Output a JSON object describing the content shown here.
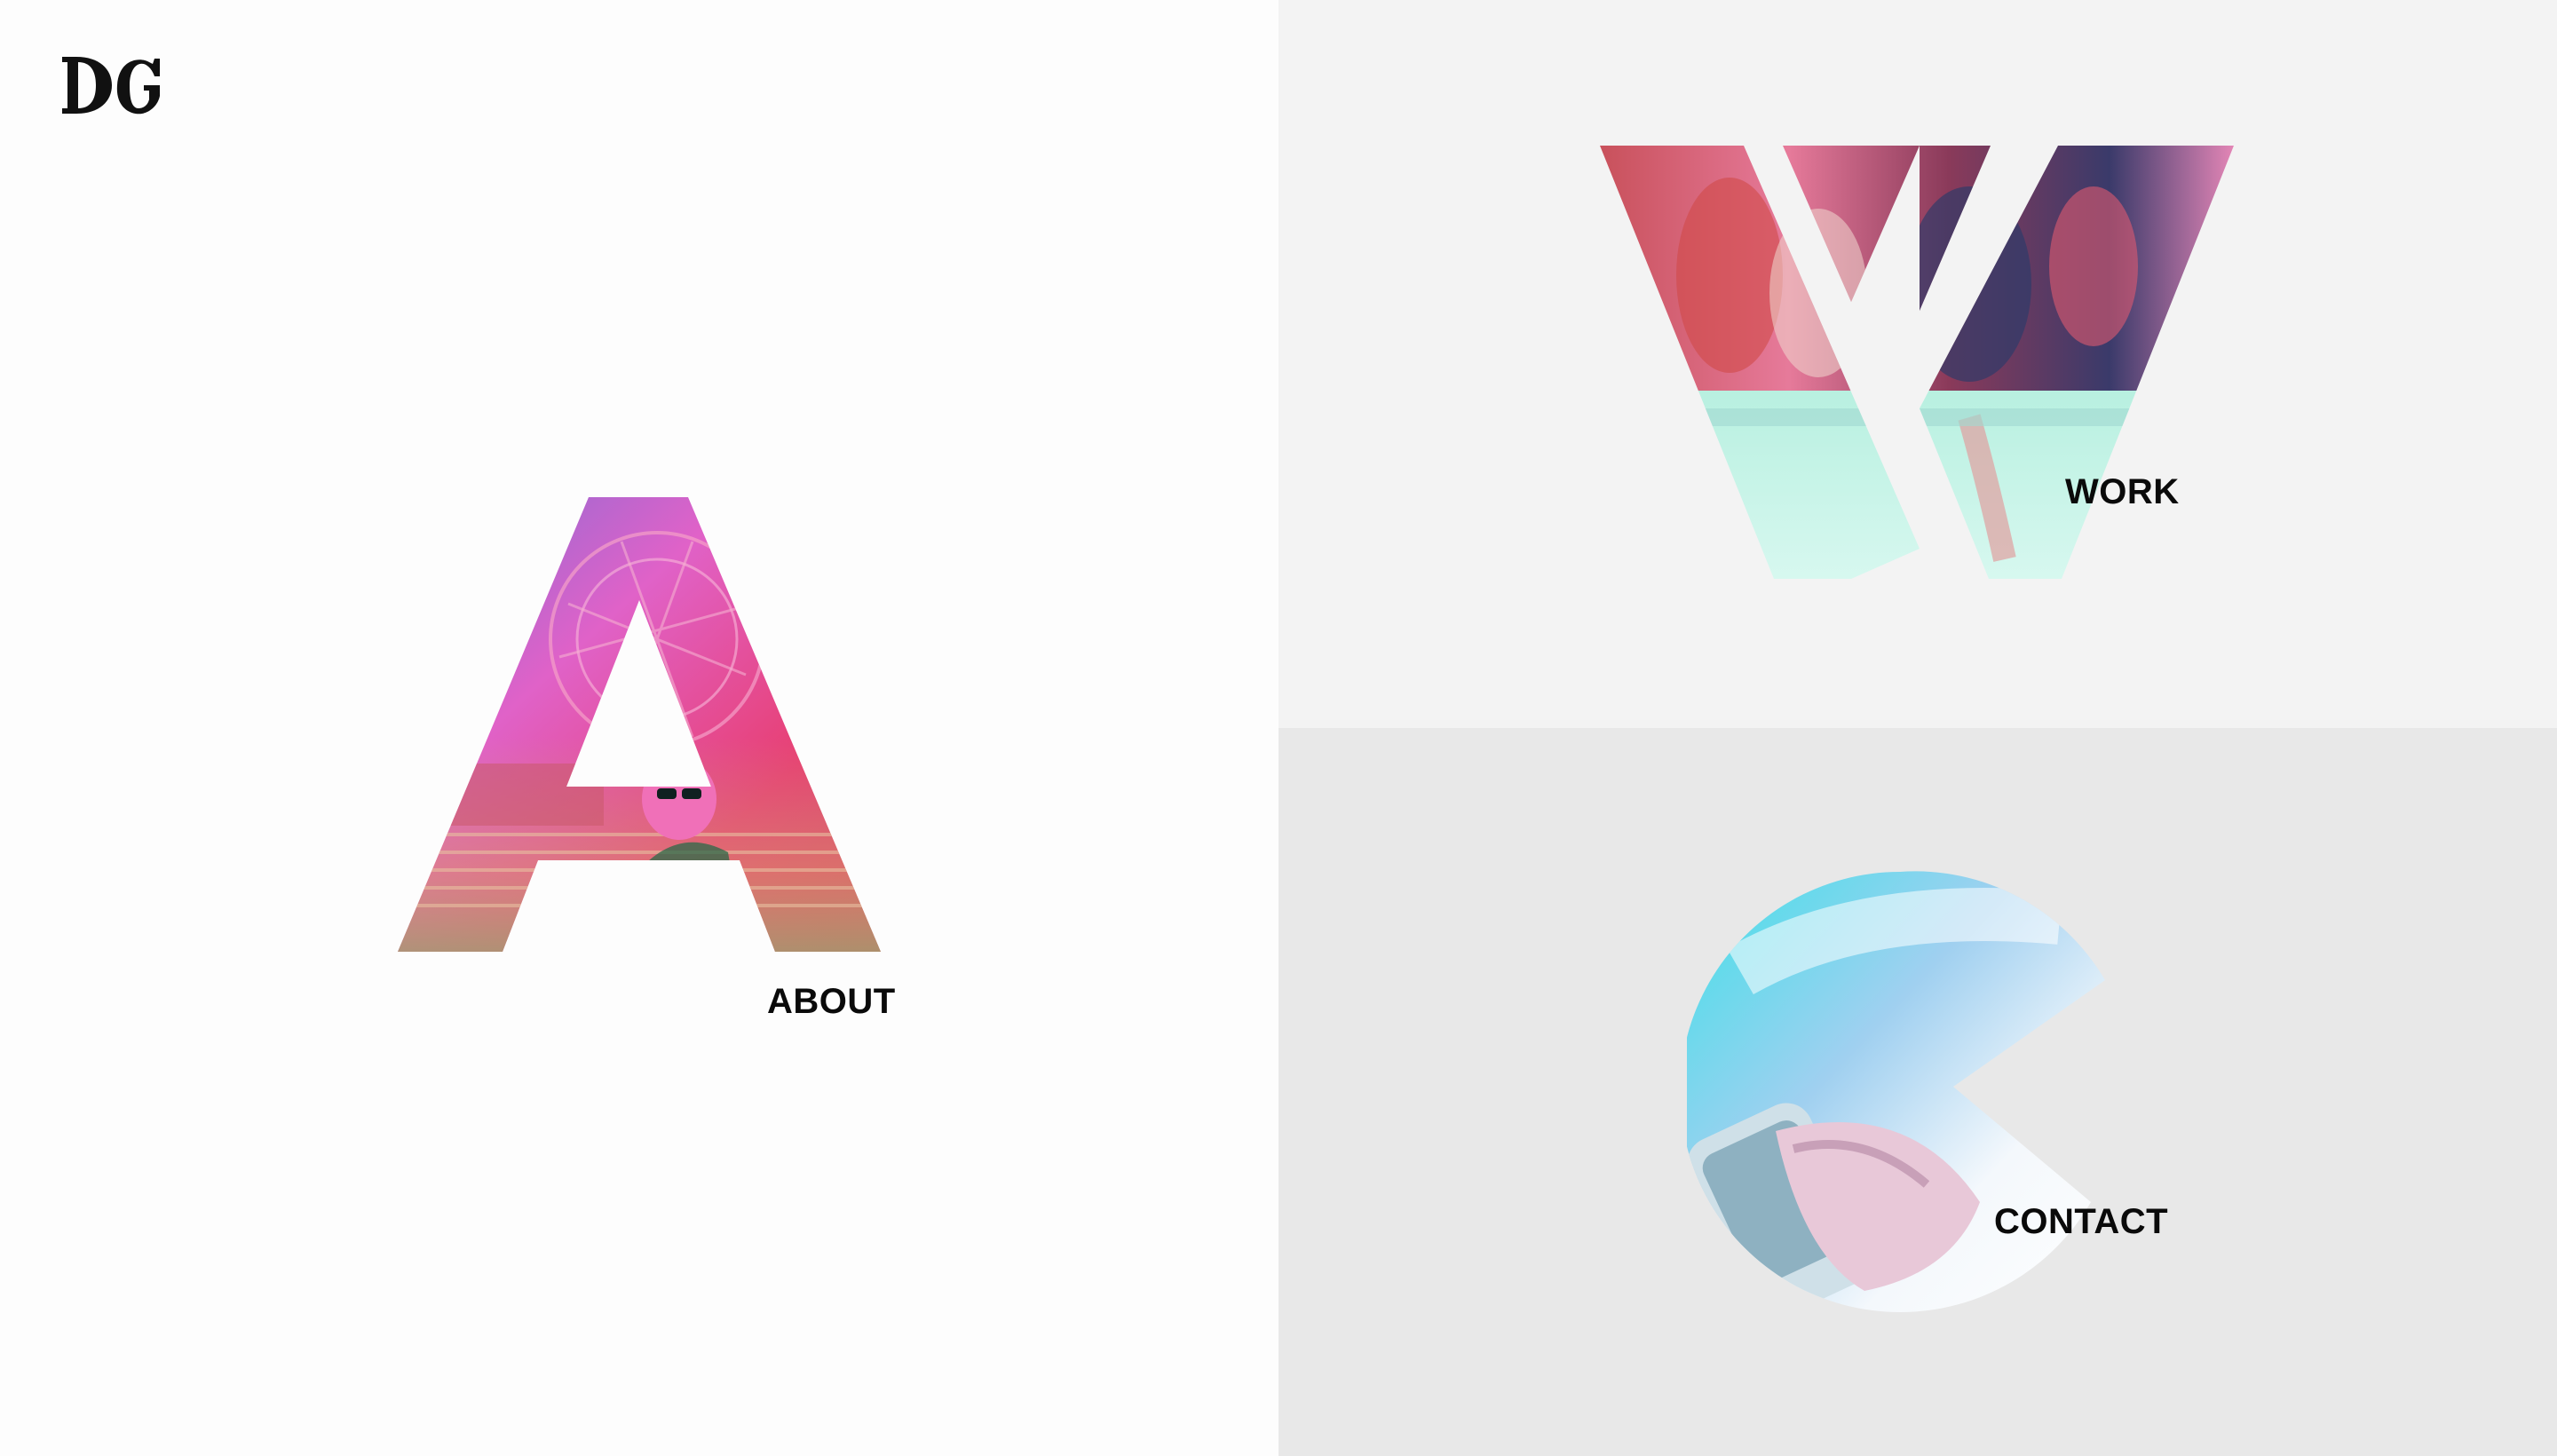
{
  "brand": {
    "logo_text": "DG"
  },
  "nav": {
    "about_label": "ABOUT",
    "work_label": "WORK",
    "contact_label": "CONTACT"
  },
  "panels": {
    "about_bg": "#fdfdfd",
    "work_bg": "#f3f3f3",
    "contact_bg": "#e8e8e8"
  }
}
